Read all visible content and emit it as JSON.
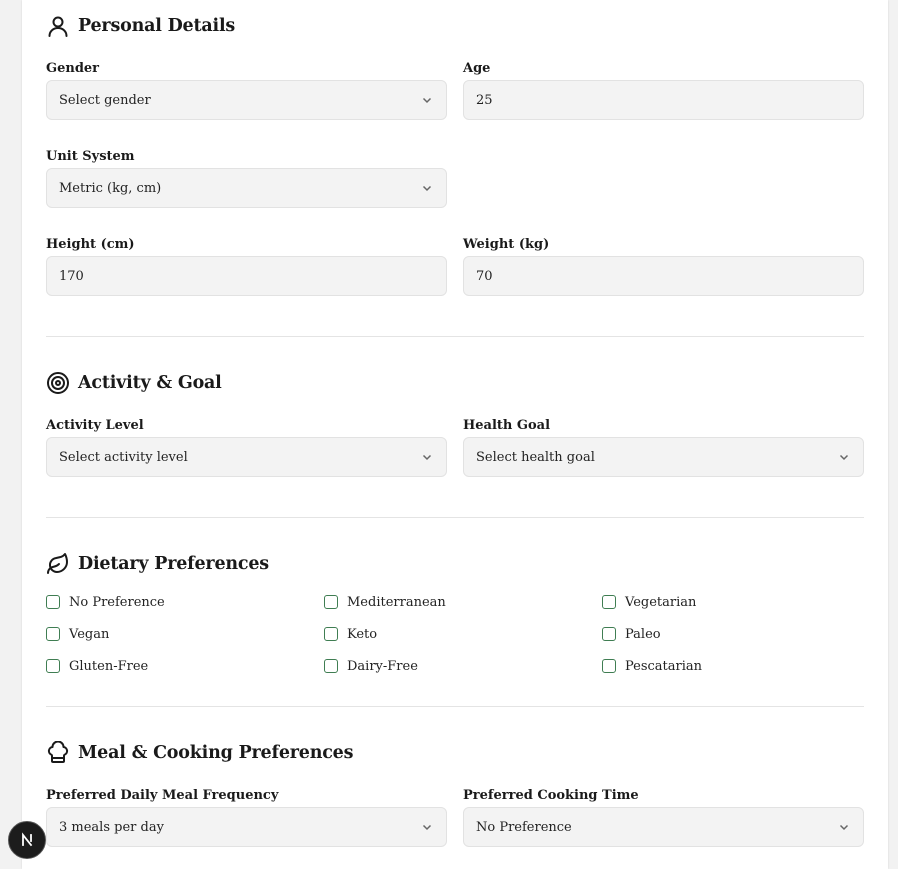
{
  "personal": {
    "title": "Personal Details",
    "icon": "user-icon",
    "gender": {
      "label": "Gender",
      "value": "Select gender"
    },
    "age": {
      "label": "Age",
      "value": "25"
    },
    "unit_system": {
      "label": "Unit System",
      "value": "Metric (kg, cm)"
    },
    "height": {
      "label": "Height (cm)",
      "value": "170"
    },
    "weight": {
      "label": "Weight (kg)",
      "value": "70"
    }
  },
  "activity": {
    "title": "Activity & Goal",
    "icon": "target-icon",
    "activity_level": {
      "label": "Activity Level",
      "value": "Select activity level"
    },
    "health_goal": {
      "label": "Health Goal",
      "value": "Select health goal"
    }
  },
  "dietary": {
    "title": "Dietary Preferences",
    "icon": "leaf-icon",
    "options": [
      "No Preference",
      "Mediterranean",
      "Vegetarian",
      "Vegan",
      "Keto",
      "Paleo",
      "Gluten-Free",
      "Dairy-Free",
      "Pescatarian"
    ]
  },
  "meal": {
    "title": "Meal & Cooking Preferences",
    "icon": "chef-hat-icon",
    "frequency": {
      "label": "Preferred Daily Meal Frequency",
      "value": "3 meals per day"
    },
    "cooking_time": {
      "label": "Preferred Cooking Time",
      "value": "No Preference"
    }
  },
  "badge": {
    "letter": "N",
    "icon": "nextjs-icon"
  },
  "colors": {
    "checkbox_border": "#3f7d52",
    "input_bg": "#f3f3f3",
    "page_bg": "#f2f2f2"
  }
}
